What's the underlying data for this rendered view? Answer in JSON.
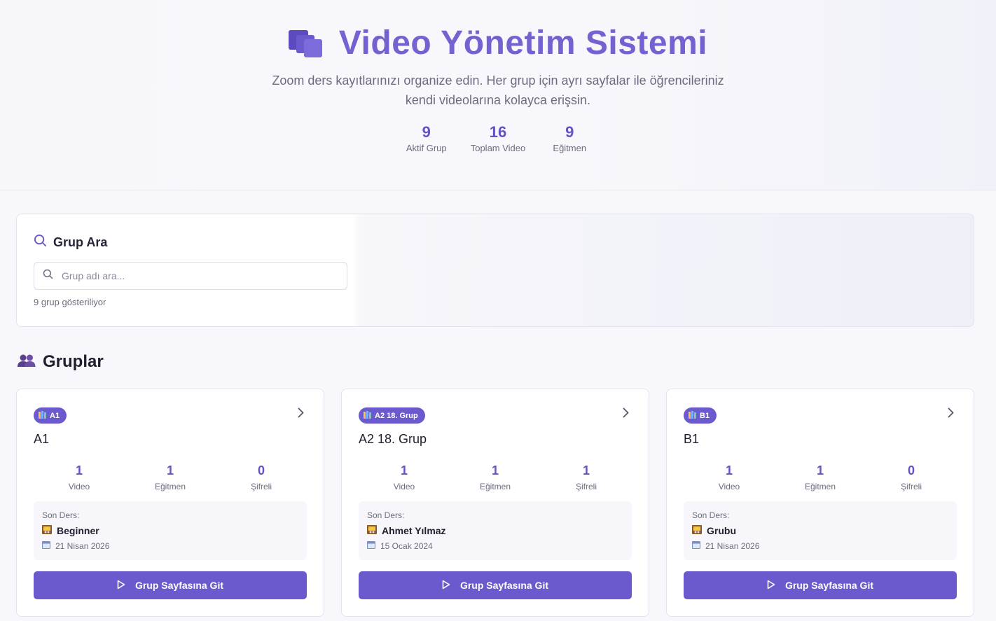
{
  "hero": {
    "title": "Video Yönetim Sistemi",
    "title_icon": "video-folder-icon",
    "subtitle_line1": "Zoom ders kayıtlarınızı organize edin. Her grup için ayrı sayfalar ile öğrencileriniz",
    "subtitle_line2": "kendi videolarına kolayca erişsin.",
    "stats": [
      {
        "value": "9",
        "label": "Aktif Grup"
      },
      {
        "value": "16",
        "label": "Toplam Video"
      },
      {
        "value": "9",
        "label": "Eğitmen"
      }
    ]
  },
  "search": {
    "heading": "Grup Ara",
    "placeholder": "Grup adı ara...",
    "value": "",
    "count_text": "9 grup gösteriliyor"
  },
  "groups": {
    "heading": "Gruplar",
    "cards": [
      {
        "badge": "A1",
        "title": "A1",
        "stats": [
          {
            "value": "1",
            "label": "Video"
          },
          {
            "value": "1",
            "label": "Eğitmen"
          },
          {
            "value": "0",
            "label": "Şifreli"
          }
        ],
        "last_label": "Son Ders:",
        "last_name": "Beginner",
        "last_date": "21 Nisan 2026",
        "button": "Grup Sayfasına Git"
      },
      {
        "badge": "A2 18. Grup",
        "title": "A2 18. Grup",
        "stats": [
          {
            "value": "1",
            "label": "Video"
          },
          {
            "value": "1",
            "label": "Eğitmen"
          },
          {
            "value": "1",
            "label": "Şifreli"
          }
        ],
        "last_label": "Son Ders:",
        "last_name": "Ahmet Yılmaz",
        "last_date": "15 Ocak 2024",
        "button": "Grup Sayfasına Git"
      },
      {
        "badge": "B1",
        "title": "B1",
        "stats": [
          {
            "value": "1",
            "label": "Video"
          },
          {
            "value": "1",
            "label": "Eğitmen"
          },
          {
            "value": "0",
            "label": "Şifreli"
          }
        ],
        "last_label": "Son Ders:",
        "last_name": "Grubu",
        "last_date": "21 Nisan 2026",
        "button": "Grup Sayfasına Git"
      }
    ]
  },
  "colors": {
    "accent": "#6a5acd",
    "title": "#7562d0",
    "stat_number": "#6153c8"
  }
}
